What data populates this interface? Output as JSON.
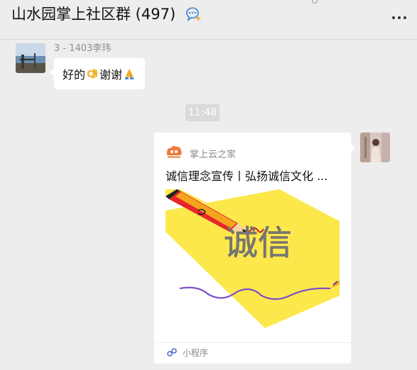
{
  "header": {
    "title": "山水园掌上社区群 (497)",
    "chat_icon": "group-chat-icon",
    "more_icon": "more-icon"
  },
  "messages": [
    {
      "sender": "3 - 1403李玮",
      "text_before": "好的",
      "emoji_1": "ok-hand-emoji",
      "text_middle": "谢谢",
      "emoji_2": "folded-hands-emoji"
    }
  ],
  "time_separator": "11:48",
  "shared_card": {
    "app_name": "掌上云之家",
    "title": "诚信理念宣传丨弘扬诚信文化 ...",
    "image_text": "诚信",
    "footer_label": "小程序",
    "footer_icon": "mini-program-icon"
  },
  "colors": {
    "background": "#ededed",
    "bubble": "#ffffff",
    "time_badge": "#dadada",
    "card_yellow": "#fde84c",
    "pencil_red": "#d01f27"
  }
}
